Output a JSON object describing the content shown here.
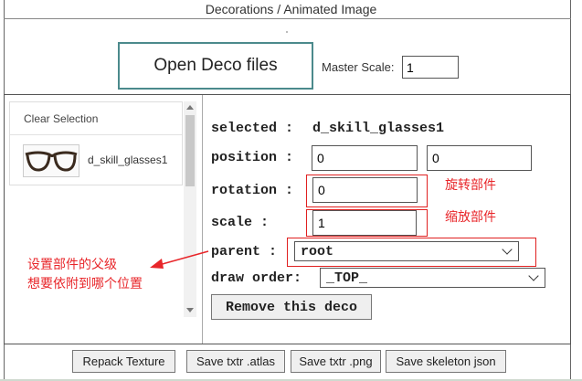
{
  "header": {
    "title": "Decorations / Animated Image"
  },
  "top": {
    "open_button": "Open Deco files",
    "master_scale_label": "Master Scale:",
    "master_scale_value": "1"
  },
  "deco_list": {
    "clear_selection": "Clear Selection",
    "items": [
      {
        "name": "d_skill_glasses1",
        "icon": "glasses-icon"
      }
    ]
  },
  "props": {
    "selected_label": "selected :",
    "selected_value": "d_skill_glasses1",
    "position_label": "position :",
    "position_x": "0",
    "position_y": "0",
    "rotation_label": "rotation :",
    "rotation_value": "0",
    "scale_label": "scale :",
    "scale_value": "1",
    "parent_label": "parent :",
    "parent_value": "root",
    "draw_order_label": "draw order:",
    "draw_order_value": "_TOP_",
    "remove_button": "Remove this deco"
  },
  "annotations": {
    "rotation_note": "旋转部件",
    "scale_note": "缩放部件",
    "parent_note_line1": "设置部件的父级",
    "parent_note_line2": "想要依附到哪个位置",
    "color": "#e8262a"
  },
  "footer_buttons": {
    "repack": "Repack Texture",
    "save_atlas": "Save txtr .atlas",
    "save_png": "Save txtr .png",
    "save_skeleton": "Save skeleton json"
  }
}
